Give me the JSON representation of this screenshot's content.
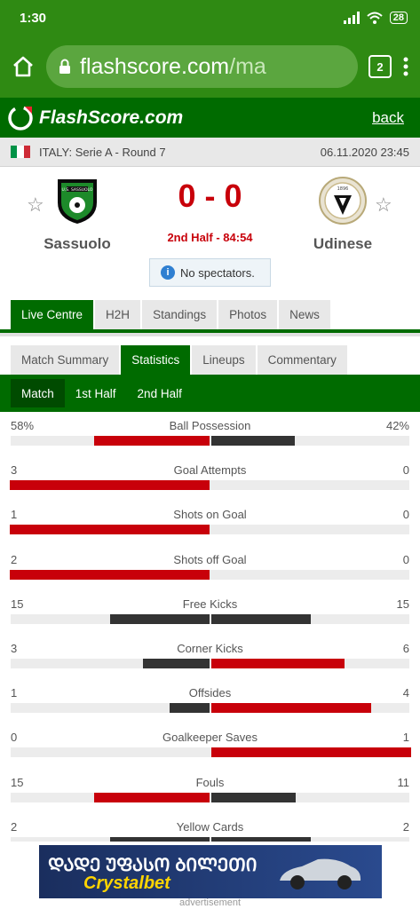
{
  "statusbar": {
    "time": "1:30",
    "battery": "28"
  },
  "browser": {
    "url_host": "flashscore.com",
    "url_path": "/ma",
    "tab_count": "2"
  },
  "header": {
    "logo_text": "FlashScore.com",
    "back_label": "back"
  },
  "league": {
    "name": "ITALY: Serie A - Round 7",
    "datetime": "06.11.2020 23:45",
    "flag_colors": [
      "#009246",
      "#ffffff",
      "#ce2b37"
    ]
  },
  "match": {
    "home": {
      "name": "Sassuolo",
      "crest_text": "U.S. SASSUOLO"
    },
    "away": {
      "name": "Udinese",
      "crest_text": "1896"
    },
    "score": "0 - 0",
    "status": "2nd Half - 84:54",
    "notice": "No spectators."
  },
  "tabs": [
    "Live Centre",
    "H2H",
    "Standings",
    "Photos",
    "News"
  ],
  "subtabs": [
    "Match Summary",
    "Statistics",
    "Lineups",
    "Commentary"
  ],
  "periods": [
    "Match",
    "1st Half",
    "2nd Half"
  ],
  "colors": {
    "home_bar": "#c8000a",
    "away_bar": "#333333",
    "win_bar": "#c8000a",
    "neutral_bar": "#333333"
  },
  "stats": [
    {
      "category": "Ball Possession",
      "home": "58%",
      "away": "42%",
      "home_val": 58,
      "away_val": 42
    },
    {
      "category": "Goal Attempts",
      "home": "3",
      "away": "0",
      "home_val": 3,
      "away_val": 0
    },
    {
      "category": "Shots on Goal",
      "home": "1",
      "away": "0",
      "home_val": 1,
      "away_val": 0
    },
    {
      "category": "Shots off Goal",
      "home": "2",
      "away": "0",
      "home_val": 2,
      "away_val": 0
    },
    {
      "category": "Free Kicks",
      "home": "15",
      "away": "15",
      "home_val": 15,
      "away_val": 15
    },
    {
      "category": "Corner Kicks",
      "home": "3",
      "away": "6",
      "home_val": 3,
      "away_val": 6
    },
    {
      "category": "Offsides",
      "home": "1",
      "away": "4",
      "home_val": 1,
      "away_val": 4
    },
    {
      "category": "Goalkeeper Saves",
      "home": "0",
      "away": "1",
      "home_val": 0,
      "away_val": 1
    },
    {
      "category": "Fouls",
      "home": "15",
      "away": "11",
      "home_val": 15,
      "away_val": 11
    },
    {
      "category": "Yellow Cards",
      "home": "2",
      "away": "2",
      "home_val": 2,
      "away_val": 2
    }
  ],
  "ad": {
    "line1": "ᲓᲐᲓᲔ ᲣᲤᲐᲡᲝ ᲑᲘᲚᲔᲗᲘ",
    "brand": "Crystalbet",
    "label": "advertisement"
  }
}
